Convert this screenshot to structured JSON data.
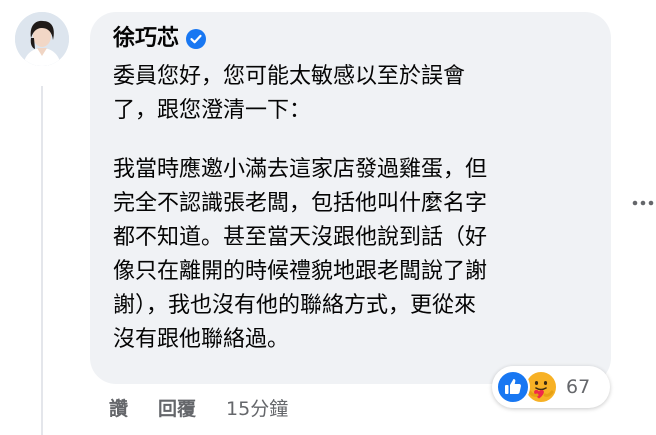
{
  "comment": {
    "author": "徐巧芯",
    "paragraphs": [
      [
        "委員您好，您可能太敏感以至於誤會",
        "了，跟您澄清一下："
      ],
      [
        "我當時應邀小滿去這家店發過雞蛋，但",
        "完全不認識張老闆，包括他叫什麼名字",
        "都不知道。甚至當天沒跟他說到話（好",
        "像只在離開的時候禮貌地跟老闆說了謝",
        "謝），我也沒有他的聯絡方式，更從來",
        "沒有跟他聯絡過。"
      ]
    ],
    "reactions": {
      "icons": [
        "like-icon",
        "care-icon"
      ],
      "count": "67"
    },
    "actions": {
      "like_label": "讚",
      "reply_label": "回覆",
      "timestamp": "15分鐘"
    }
  },
  "colors": {
    "bubble": "#f0f2f5",
    "text": "#050505",
    "secondary": "#65676b",
    "verified": "#1877f2",
    "like": "#1877f2",
    "care": "#f7b125"
  }
}
